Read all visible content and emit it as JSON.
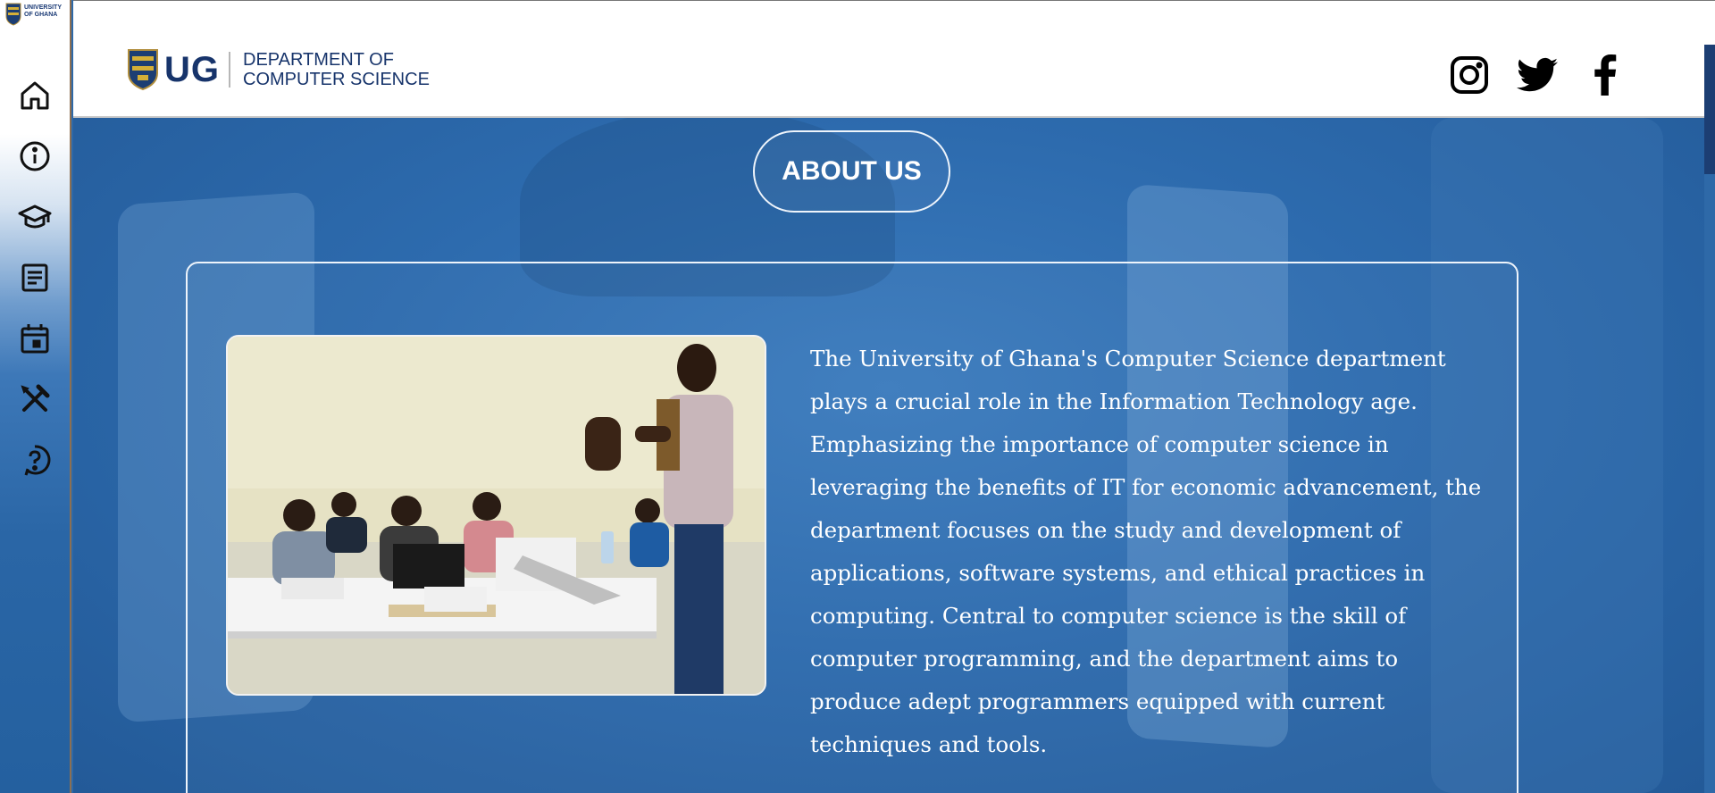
{
  "sidebar": {
    "logo_text_line1": "UNIVERSITY",
    "logo_text_line2": "OF GHANA",
    "items": [
      {
        "icon": "home-icon",
        "label": "Home"
      },
      {
        "icon": "info-icon",
        "label": "About"
      },
      {
        "icon": "graduation-cap-icon",
        "label": "Programmes"
      },
      {
        "icon": "document-icon",
        "label": "News"
      },
      {
        "icon": "calendar-icon",
        "label": "Events"
      },
      {
        "icon": "tools-icon",
        "label": "Resources"
      },
      {
        "icon": "help-icon",
        "label": "Help"
      }
    ]
  },
  "header": {
    "brand_short": "UG",
    "dept_line1": "DEPARTMENT OF",
    "dept_line2": "COMPUTER SCIENCE",
    "social": [
      "instagram-icon",
      "twitter-icon",
      "facebook-icon"
    ]
  },
  "about": {
    "heading": "ABOUT US",
    "paragraph": "The University of Ghana's Computer Science department plays a crucial role in the Information Technology age. Emphasizing the importance of computer science in leveraging the benefits of IT for economic advancement, the department focuses on the study and development of applications, software systems, and ethical practices in computing. Central to computer science is the skill of computer programming, and the department aims to produce adept programmers equipped with current techniques and tools."
  },
  "colors": {
    "brand_navy": "#17346b",
    "hero_blue": "#2e69a8",
    "white": "#ffffff"
  }
}
